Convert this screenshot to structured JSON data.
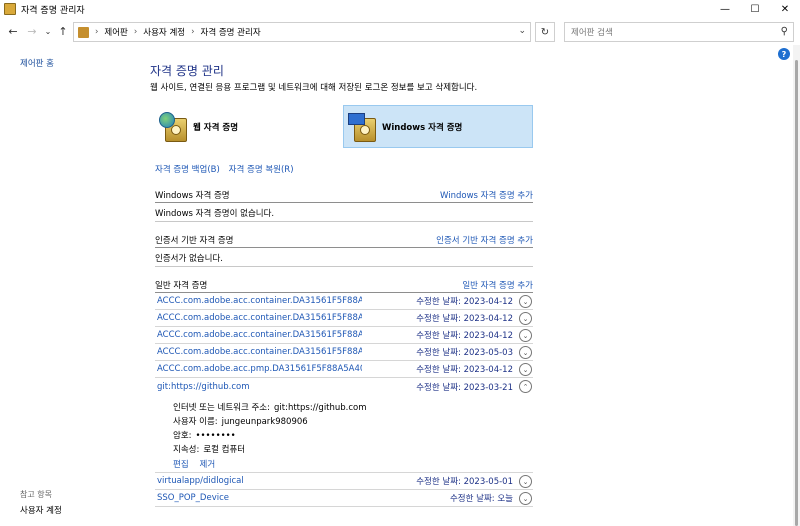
{
  "window": {
    "title": "자격 증명 관리자",
    "minimize": "—",
    "maximize": "☐",
    "close": "✕"
  },
  "nav": {
    "back": "←",
    "forward": "→",
    "recent": "⌄",
    "up": "↑",
    "breadcrumb": [
      "제어판",
      "사용자 계정",
      "자격 증명 관리자"
    ],
    "breadcrumb_sep": "›",
    "search_placeholder": "제어판 검색"
  },
  "sidebar": {
    "home_link": "제어판 홈",
    "see_also_label": "참고 항목",
    "see_also_link": "사용자 계정"
  },
  "main": {
    "title": "자격 증명 관리",
    "description": "웹 사이트, 연결된 응용 프로그램 및 네트워크에 대해 저장된 로그온 정보를 보고 삭제합니다.",
    "categories": {
      "web": "웹 자격 증명",
      "windows": "Windows 자격 증명"
    },
    "backup_link": "자격 증명 백업(B)",
    "restore_link": "자격 증명 복원(R)",
    "windows_section": {
      "heading": "Windows 자격 증명",
      "add_link": "Windows 자격 증명 추가",
      "empty": "Windows 자격 증명이 없습니다."
    },
    "cert_section": {
      "heading": "인증서 기반 자격 증명",
      "add_link": "인증서 기반 자격 증명 추가",
      "empty": "인증서가 없습니다."
    },
    "generic_section": {
      "heading": "일반 자격 증명",
      "add_link": "일반 자격 증명 추가"
    },
    "modified_label": "수정한 날짜:",
    "credentials": [
      {
        "name": "ACCC.com.adobe.acc.container.DA31561F5F88A5A4...",
        "date": "2023-04-12",
        "expanded": false
      },
      {
        "name": "ACCC.com.adobe.acc.container.DA31561F5F88A5A4...",
        "date": "2023-04-12",
        "expanded": false
      },
      {
        "name": "ACCC.com.adobe.acc.container.DA31561F5F88A5A4...",
        "date": "2023-04-12",
        "expanded": false
      },
      {
        "name": "ACCC.com.adobe.acc.container.DA31561F5F88A5A4...",
        "date": "2023-05-03",
        "expanded": false
      },
      {
        "name": "ACCC.com.adobe.acc.pmp.DA31561F5F88A5A40A4...",
        "date": "2023-04-12",
        "expanded": false
      },
      {
        "name": "git:https://github.com",
        "date": "2023-03-21",
        "expanded": true
      },
      {
        "name": "virtualapp/didlogical",
        "date": "2023-05-01",
        "expanded": false
      },
      {
        "name": "SSO_POP_Device",
        "date": "오늘",
        "expanded": false
      }
    ],
    "detail": {
      "address_label": "인터넷 또는 네트워크 주소:",
      "address_value": "git:https://github.com",
      "user_label": "사용자 이름:",
      "user_value": "jungeunpark980906",
      "password_label": "암호:",
      "password_value": "••••••••",
      "persistence_label": "지속성:",
      "persistence_value": "로컬 컴퓨터",
      "edit_link": "편집",
      "remove_link": "제거"
    }
  }
}
